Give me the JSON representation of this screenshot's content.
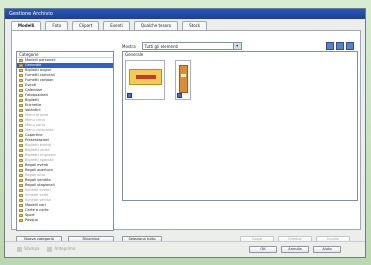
{
  "window": {
    "title": "Gestione Archivio"
  },
  "tabs": [
    {
      "label": "Modelli",
      "active": true
    },
    {
      "label": "Foto",
      "active": false
    },
    {
      "label": "Clipart",
      "active": false
    },
    {
      "label": "Eventi",
      "active": false
    },
    {
      "label": "Qualche tesoro",
      "active": false
    },
    {
      "label": "Stock",
      "active": false
    }
  ],
  "filter": {
    "label": "Mostra",
    "selected": "Tutti gli elementi"
  },
  "sidebar": {
    "header": "Categorie",
    "items": [
      {
        "label": "Modelli personali",
        "muted": false,
        "selected": false
      },
      {
        "label": "Generale",
        "muted": false,
        "selected": true
      },
      {
        "label": "Biglietti auguri",
        "muted": false,
        "selected": false
      },
      {
        "label": "Fumetti comicali",
        "muted": false,
        "selected": false
      },
      {
        "label": "Fumetti cartoon",
        "muted": false,
        "selected": false
      },
      {
        "label": "Eventi",
        "muted": false,
        "selected": false
      },
      {
        "label": "Calendari",
        "muted": false,
        "selected": false
      },
      {
        "label": "Fotoquadrati",
        "muted": false,
        "selected": false
      },
      {
        "label": "Biglietti",
        "muted": false,
        "selected": false
      },
      {
        "label": "Etichette",
        "muted": false,
        "selected": false
      },
      {
        "label": "Volantini",
        "muted": false,
        "selected": false
      },
      {
        "label": "Menu pranzo",
        "muted": true,
        "selected": false
      },
      {
        "label": "Menu cena",
        "muted": true,
        "selected": false
      },
      {
        "label": "Menu vario",
        "muted": true,
        "selected": false
      },
      {
        "label": "Menu ristorante",
        "muted": true,
        "selected": false
      },
      {
        "label": "Copertine",
        "muted": false,
        "selected": false
      },
      {
        "label": "Presentazioni",
        "muted": false,
        "selected": false
      },
      {
        "label": "Biglietti eventi",
        "muted": true,
        "selected": false
      },
      {
        "label": "Biglietti visita",
        "muted": true,
        "selected": false
      },
      {
        "label": "Biglietti ringrazio",
        "muted": true,
        "selected": false
      },
      {
        "label": "Biglietti speciali",
        "muted": true,
        "selected": false
      },
      {
        "label": "Regali eventi",
        "muted": false,
        "selected": false
      },
      {
        "label": "Regali apertura",
        "muted": false,
        "selected": false
      },
      {
        "label": "Regali altro",
        "muted": true,
        "selected": false
      },
      {
        "label": "Regali vendita",
        "muted": false,
        "selected": false
      },
      {
        "label": "Regali stagionali",
        "muted": false,
        "selected": false
      },
      {
        "label": "Schede eventi",
        "muted": true,
        "selected": false
      },
      {
        "label": "Schede varie",
        "muted": true,
        "selected": false
      },
      {
        "label": "Schede servizi",
        "muted": true,
        "selected": false
      },
      {
        "label": "Modelli vari",
        "muted": false,
        "selected": false
      },
      {
        "label": "Carte e carte",
        "muted": false,
        "selected": false
      },
      {
        "label": "Sport",
        "muted": false,
        "selected": false
      },
      {
        "label": "Pasqua",
        "muted": false,
        "selected": false
      }
    ]
  },
  "content": {
    "header": "Generale"
  },
  "buttons": {
    "new_category": "Nuova categoria",
    "rename": "Rinomina",
    "select_all": "Seleziona tutto",
    "deselect_all": "Deseleziona tutto",
    "copy": "Copia",
    "delete": "Elimina",
    "paste": "Incolla",
    "delete_small": "Elimina",
    "import": "Importa",
    "ok": "OK",
    "cancel": "Annulla",
    "help": "Aiuto"
  },
  "bottom": {
    "left1": "Stampa",
    "left2": "Anteprima"
  }
}
